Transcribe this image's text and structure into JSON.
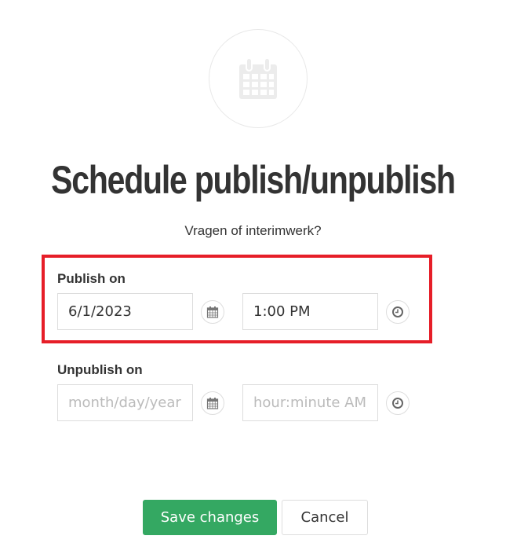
{
  "header": {
    "icon": "calendar-icon",
    "title": "Schedule publish/unpublish",
    "subtitle": "Vragen of interimwerk?"
  },
  "publish": {
    "label": "Publish on",
    "date_value": "6/1/2023",
    "time_value": "1:00 PM",
    "date_icon": "calendar-icon",
    "time_icon": "clock-icon",
    "highlight_color": "#e61e28"
  },
  "unpublish": {
    "label": "Unpublish on",
    "date_placeholder": "month/day/year",
    "time_placeholder": "hour:minute AM",
    "date_icon": "calendar-icon",
    "time_icon": "clock-icon"
  },
  "actions": {
    "save_label": "Save changes",
    "cancel_label": "Cancel",
    "save_color": "#34a862"
  }
}
